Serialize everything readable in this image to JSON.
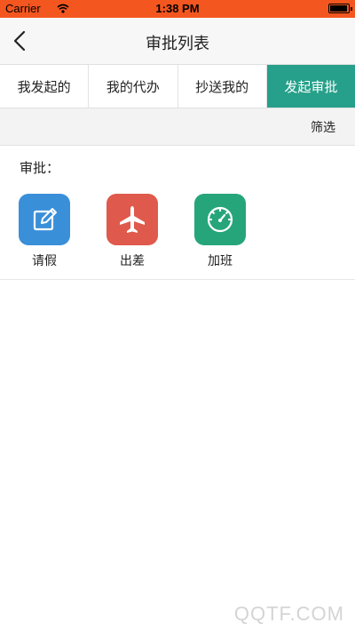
{
  "status_bar": {
    "carrier": "Carrier",
    "time": "1:38 PM",
    "accent_color": "#f4561f"
  },
  "nav": {
    "title": "审批列表",
    "back_icon": "chevron-left-icon"
  },
  "tabs": [
    {
      "label": "我发起的",
      "active": false
    },
    {
      "label": "我的代办",
      "active": false
    },
    {
      "label": "抄送我的",
      "active": false
    },
    {
      "label": "发起审批",
      "active": true
    }
  ],
  "tab_active_color": "#26a08a",
  "filter": {
    "label": "筛选"
  },
  "section": {
    "label": "审批："
  },
  "apps": [
    {
      "label": "请假",
      "icon": "edit-icon",
      "color": "#3a8fd9"
    },
    {
      "label": "出差",
      "icon": "airplane-icon",
      "color": "#df5a4c"
    },
    {
      "label": "加班",
      "icon": "speedometer-icon",
      "color": "#26a57b"
    }
  ],
  "watermark": "QQTF.COM"
}
